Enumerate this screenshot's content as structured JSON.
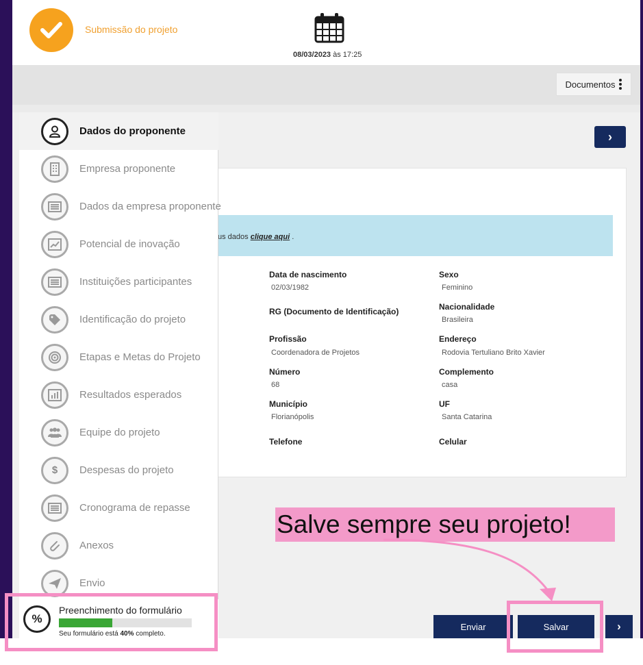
{
  "header": {
    "submission_title": "Submissão do projeto",
    "date": "08/03/2023",
    "time_text": " às 17:25",
    "documents_label": "Documentos",
    "colors": {
      "check": "#f6a21e",
      "title": "#f0a030"
    },
    "icons": {
      "status": "check-icon",
      "calendar": "calendar-icon",
      "menu": "kebab-icon"
    }
  },
  "sidebar": {
    "items": [
      {
        "label": "Dados do proponente",
        "icon": "user-icon",
        "active": true
      },
      {
        "label": "Empresa proponente",
        "icon": "building-icon"
      },
      {
        "label": "Dados da empresa proponente",
        "icon": "list-icon"
      },
      {
        "label": "Potencial de inovação",
        "icon": "trend-chart-icon"
      },
      {
        "label": "Instituições participantes",
        "icon": "list-icon"
      },
      {
        "label": "Identificação do projeto",
        "icon": "tag-icon"
      },
      {
        "label": "Etapas e Metas do Projeto",
        "icon": "target-icon"
      },
      {
        "label": "Resultados esperados",
        "icon": "bar-chart-icon"
      },
      {
        "label": "Equipe do projeto",
        "icon": "team-icon"
      },
      {
        "label": "Despesas do projeto",
        "icon": "dollar-icon"
      },
      {
        "label": "Cronograma de repasse",
        "icon": "list-icon"
      },
      {
        "label": "Anexos",
        "icon": "paperclip-icon"
      },
      {
        "label": "Envio",
        "icon": "send-icon"
      }
    ]
  },
  "progress": {
    "title": "Preenchimento do formulário",
    "percent": 40,
    "note_prefix": "Seu formulário está ",
    "note_value": "40%",
    "note_suffix": " completo.",
    "fill_color": "#3aa635"
  },
  "info": {
    "text": "us dados ",
    "link": "clique aqui",
    "end": " ."
  },
  "fields": {
    "birth_label": "Data de nascimento",
    "birth_value": "02/03/1982",
    "sex_label": "Sexo",
    "sex_value": "Feminino",
    "rg_label": "RG (Documento de Identificação)",
    "nationality_label": "Nacionalidade",
    "nationality_value": "Brasileira",
    "profession_label": "Profissão",
    "profession_value": "Coordenadora de Projetos",
    "address_label": "Endereço",
    "address_value": "Rodovia Tertuliano Brito Xavier",
    "number_label": "Número",
    "number_value": "68",
    "complement_label": "Complemento",
    "complement_value": "casa",
    "city_label": "Município",
    "city_value": "Florianópolis",
    "state_label": "UF",
    "state_value": "Santa Catarina",
    "phone_label": "Telefone",
    "mobile_label": "Celular"
  },
  "buttons": {
    "send": "Enviar",
    "save": "Salvar",
    "next_symbol": "›",
    "color": "#152a5e"
  },
  "annotation": {
    "callout": "Salve sempre seu projeto!",
    "highlight_color": "#f58fc4"
  }
}
